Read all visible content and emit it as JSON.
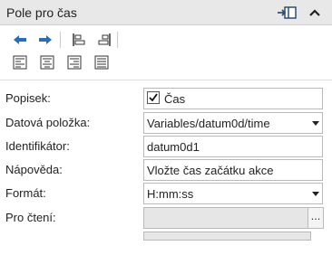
{
  "header": {
    "title": "Pole pro čas"
  },
  "toolbar": {
    "icons": [
      "arrow-left-icon",
      "arrow-right-icon",
      "align-top-left-icon",
      "align-top-right-icon",
      "align-left-text-icon",
      "align-center-text-icon",
      "align-right-text-icon",
      "justify-text-icon"
    ]
  },
  "form": {
    "caption_label": "Popisek:",
    "caption_checked": true,
    "caption_value": "Čas",
    "data_item_label": "Datová položka:",
    "data_item_value": "Variables/datum0d/time",
    "id_label": "Identifikátor:",
    "id_value": "datum0d1",
    "help_label": "Nápověda:",
    "help_value": "Vložte čas začátku akce",
    "format_label": "Formát:",
    "format_value": "H:mm:ss",
    "readonly_label": "Pro čtení:",
    "readonly_value": "",
    "ellipsis": "..."
  },
  "colors": {
    "header_bg": "#e8e8e8",
    "icon_blue": "#2b6cb8",
    "readonly_bg": "#e6e6e6"
  }
}
